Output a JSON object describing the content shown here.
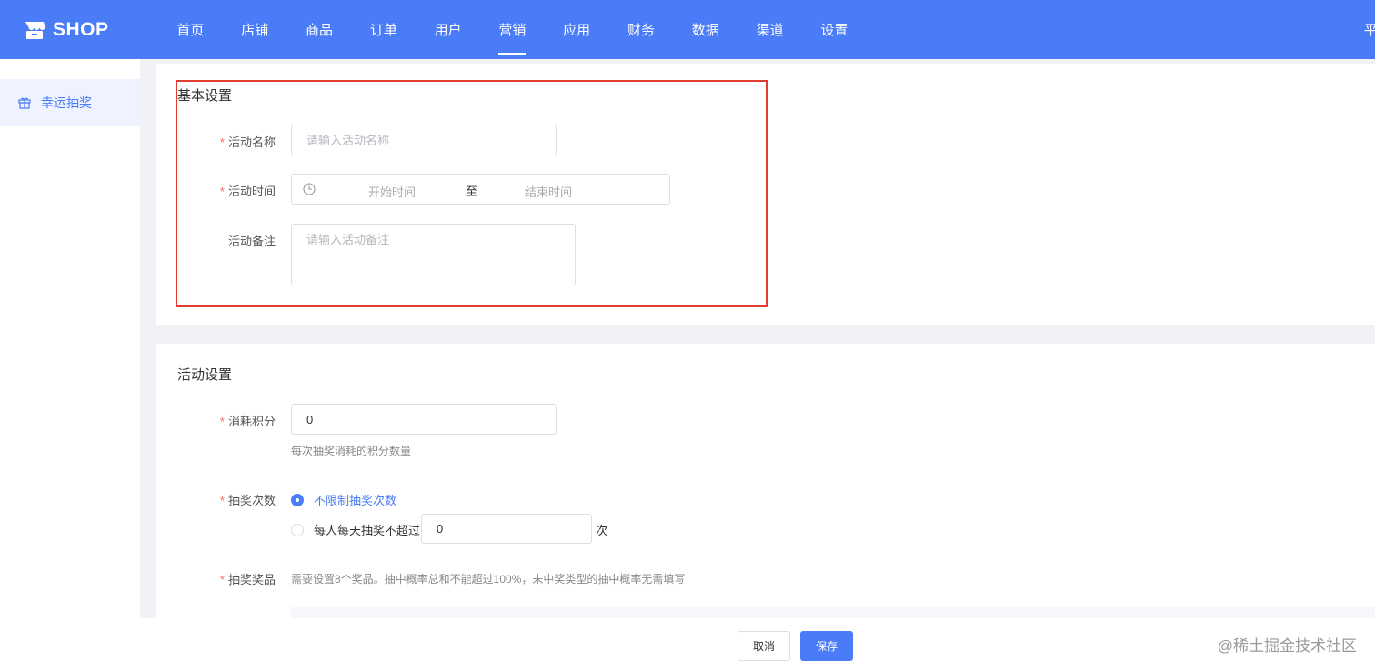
{
  "brand": {
    "name": "SHOP",
    "color": "#4a7cf7"
  },
  "nav": {
    "items": [
      "首页",
      "店铺",
      "商品",
      "订单",
      "用户",
      "营销",
      "应用",
      "财务",
      "数据",
      "渠道",
      "设置"
    ],
    "active": "营销",
    "right_text": "平"
  },
  "sidebar": {
    "items": [
      {
        "label": "幸运抽奖",
        "icon": "gift-icon",
        "active": true
      }
    ]
  },
  "basic": {
    "title": "基本设置",
    "name_label": "活动名称",
    "name_placeholder": "请输入活动名称",
    "time_label": "活动时间",
    "start_placeholder": "开始时间",
    "range_separator": "至",
    "end_placeholder": "结束时间",
    "remark_label": "活动备注",
    "remark_placeholder": "请输入活动备注"
  },
  "activity": {
    "title": "活动设置",
    "points_label": "消耗积分",
    "points_value": "0",
    "points_hint": "每次抽奖消耗的积分数量",
    "count_label": "抽奖次数",
    "unlimited_option": "不限制抽奖次数",
    "limit_option": "每人每天抽奖不超过",
    "limit_value": "0",
    "limit_unit": "次",
    "prize_label": "抽奖奖品",
    "prize_hint": "需要设置8个奖品。抽中概率总和不能超过100%，未中奖类型的抽中概率无需填写"
  },
  "footer": {
    "cancel_label": "取消",
    "save_label": "保存"
  },
  "watermark": "@稀土掘金技术社区",
  "colors": {
    "accent": "#4a7cf7",
    "required": "#f56c6c",
    "highlight": "#e03c31"
  }
}
